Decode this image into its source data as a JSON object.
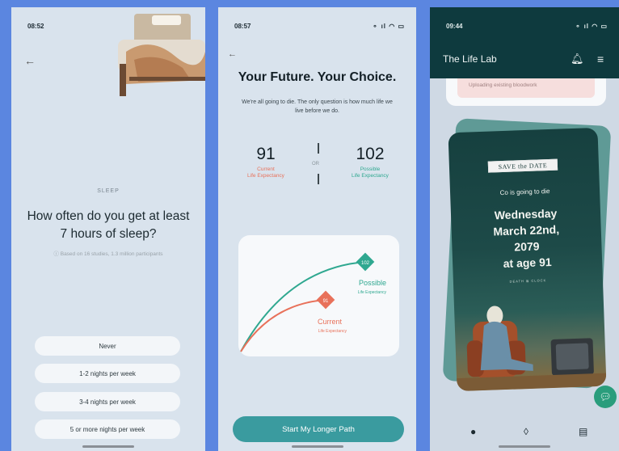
{
  "screen1": {
    "status_time": "08:52",
    "category": "SLEEP",
    "question": "How often do you get at least 7 hours of sleep?",
    "note": "ⓘ Based on 16 studies, 1.3 million participants",
    "options": [
      "Never",
      "1-2 nights per week",
      "3-4 nights per week",
      "5 or more nights per week"
    ]
  },
  "screen2": {
    "status_time": "08:57",
    "title": "Your Future. Your Choice.",
    "subtitle": "We're all going to die. The only question is how much life we live before we do.",
    "current": {
      "value": "91",
      "label": "Current\nLife Expectancy"
    },
    "or_label": "OR",
    "possible": {
      "value": "102",
      "label": "Possible\nLife Expectancy"
    },
    "chart": {
      "possible_marker": "102",
      "possible_label": "Possible",
      "possible_sublabel": "Life Expectancy",
      "current_marker": "91",
      "current_label": "Current",
      "current_sublabel": "Life Expectancy"
    },
    "button_label": "Start My Longer Path"
  },
  "screen3": {
    "status_time": "09:44",
    "app_title": "The Life Lab",
    "upload_text": "Uploading existing bloodwork",
    "save_the_date": "SAVE the DATE",
    "dies_text": "Co is going to die",
    "date_lines": [
      "Wednesday",
      "March 22nd,",
      "2079",
      "at age 91"
    ],
    "brand_left": "DEATH",
    "brand_right": "CLOCK"
  },
  "colors": {
    "current": "#e8715a",
    "possible": "#2fa890",
    "background": "#5b86e0",
    "topbar": "#0e3a3e"
  }
}
